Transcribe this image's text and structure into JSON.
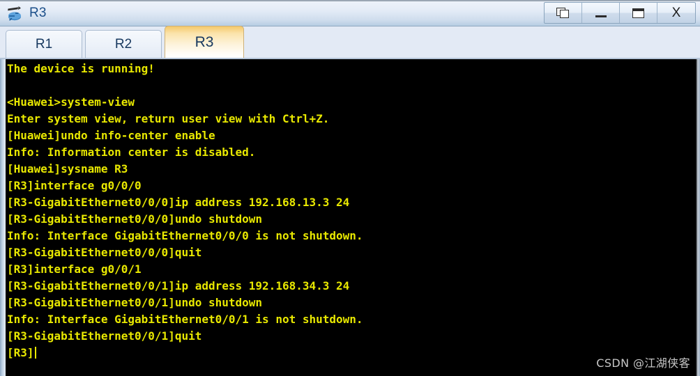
{
  "window": {
    "title": "R3",
    "icon": "router-icon",
    "controls": [
      {
        "name": "restore-button",
        "label": "Restore"
      },
      {
        "name": "minimize-button",
        "label": "_"
      },
      {
        "name": "maximize-button",
        "label": "Maximize"
      },
      {
        "name": "close-button",
        "label": "X"
      }
    ]
  },
  "tabs": [
    {
      "label": "R1",
      "active": false
    },
    {
      "label": "R2",
      "active": false
    },
    {
      "label": "R3",
      "active": true
    }
  ],
  "terminal": {
    "foreground": "#e8e800",
    "background": "#000000",
    "cursor_visible": true,
    "lines": [
      "The device is running!",
      "",
      "<Huawei>system-view",
      "Enter system view, return user view with Ctrl+Z.",
      "[Huawei]undo info-center enable",
      "Info: Information center is disabled.",
      "[Huawei]sysname R3",
      "[R3]interface g0/0/0",
      "[R3-GigabitEthernet0/0/0]ip address 192.168.13.3 24",
      "[R3-GigabitEthernet0/0/0]undo shutdown",
      "Info: Interface GigabitEthernet0/0/0 is not shutdown.",
      "[R3-GigabitEthernet0/0/0]quit",
      "[R3]interface g0/0/1",
      "[R3-GigabitEthernet0/0/1]ip address 192.168.34.3 24",
      "[R3-GigabitEthernet0/0/1]undo shutdown",
      "Info: Interface GigabitEthernet0/0/1 is not shutdown.",
      "[R3-GigabitEthernet0/0/1]quit"
    ],
    "prompt_line": "[R3]"
  },
  "watermark": {
    "text": "CSDN @江湖侠客"
  }
}
